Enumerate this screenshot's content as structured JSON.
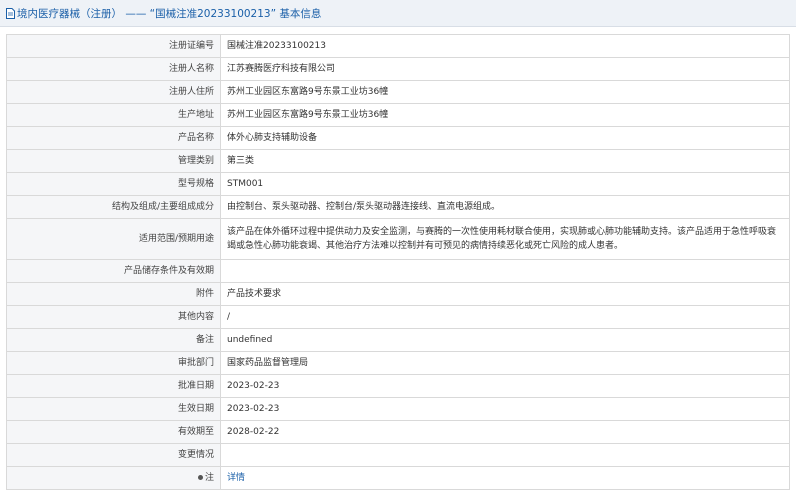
{
  "header": {
    "title": "境内医疗器械（注册） —— “国械注准20233100213” 基本信息"
  },
  "rows": [
    {
      "label": "注册证编号",
      "value": "国械注准20233100213"
    },
    {
      "label": "注册人名称",
      "value": "江苏赛腾医疗科技有限公司"
    },
    {
      "label": "注册人住所",
      "value": "苏州工业园区东富路9号东景工业坊36幢"
    },
    {
      "label": "生产地址",
      "value": "苏州工业园区东富路9号东景工业坊36幢"
    },
    {
      "label": "产品名称",
      "value": "体外心肺支持辅助设备"
    },
    {
      "label": "管理类别",
      "value": "第三类"
    },
    {
      "label": "型号规格",
      "value": "STM001"
    },
    {
      "label": "结构及组成/主要组成成分",
      "value": "由控制台、泵头驱动器、控制台/泵头驱动器连接线、直流电源组成。"
    },
    {
      "label": "适用范围/预期用途",
      "value": "该产品在体外循环过程中提供动力及安全监测，与赛腾的一次性使用耗材联合使用，实现肺或心肺功能辅助支持。该产品适用于急性呼吸衰竭或急性心肺功能衰竭、其他治疗方法难以控制并有可预见的病情持续恶化或死亡风险的成人患者。"
    },
    {
      "label": "产品储存条件及有效期",
      "value": ""
    },
    {
      "label": "附件",
      "value": "产品技术要求"
    },
    {
      "label": "其他内容",
      "value": "/"
    },
    {
      "label": "备注",
      "value": "undefined"
    },
    {
      "label": "审批部门",
      "value": "国家药品监督管理局"
    },
    {
      "label": "批准日期",
      "value": "2023-02-23"
    },
    {
      "label": "生效日期",
      "value": "2023-02-23"
    },
    {
      "label": "有效期至",
      "value": "2028-02-22"
    },
    {
      "label": "变更情况",
      "value": ""
    },
    {
      "label": "注",
      "value": "详情"
    }
  ]
}
